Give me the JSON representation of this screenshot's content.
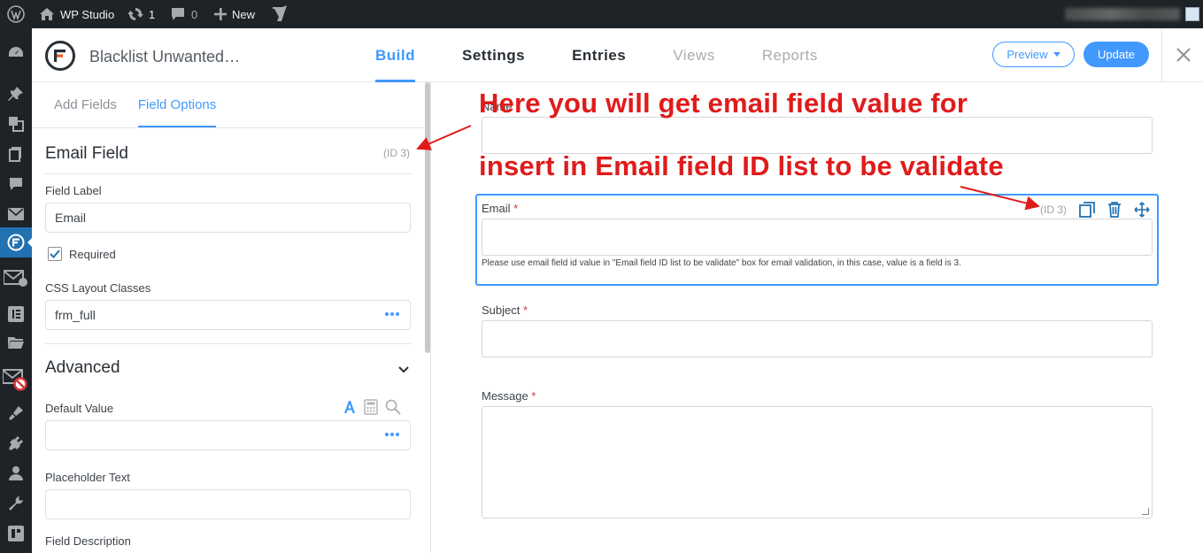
{
  "adminbar": {
    "site_name": "WP Studio",
    "updates_count": "1",
    "comments_count": "0",
    "new_label": "New"
  },
  "header": {
    "form_title": "Blacklist Unwanted…",
    "tabs": [
      {
        "label": "Build",
        "state": "active"
      },
      {
        "label": "Settings",
        "state": "normal"
      },
      {
        "label": "Entries",
        "state": "normal"
      },
      {
        "label": "Views",
        "state": "disabled"
      },
      {
        "label": "Reports",
        "state": "disabled"
      }
    ],
    "preview_label": "Preview",
    "update_label": "Update"
  },
  "left_panel": {
    "tabs": [
      {
        "label": "Add Fields"
      },
      {
        "label": "Field Options"
      }
    ],
    "section_title": "Email Field",
    "section_id": "(ID 3)",
    "field_label_caption": "Field Label",
    "field_label_value": "Email",
    "required_label": "Required",
    "required_checked": true,
    "css_classes_caption": "CSS Layout Classes",
    "css_classes_value": "frm_full",
    "advanced_title": "Advanced",
    "default_value_caption": "Default Value",
    "placeholder_caption": "Placeholder Text",
    "description_caption": "Field Description"
  },
  "canvas": {
    "fields": [
      {
        "label": "Name",
        "required": false
      },
      {
        "label": "Email",
        "required": true,
        "id_badge": "(ID 3)",
        "description": "Please use email field id value in \"Email field ID list to be validate\" box for email validation, in this case, value is a field is 3."
      },
      {
        "label": "Subject",
        "required": true
      },
      {
        "label": "Message",
        "required": true
      }
    ],
    "required_marker": "*"
  },
  "annotations": {
    "line1": "Here you will get email field value for",
    "line2": "insert in Email field ID list to be validate"
  },
  "colors": {
    "accent": "#4199fd",
    "admin_bg": "#1d2327",
    "annotation": "#e01b1b"
  }
}
